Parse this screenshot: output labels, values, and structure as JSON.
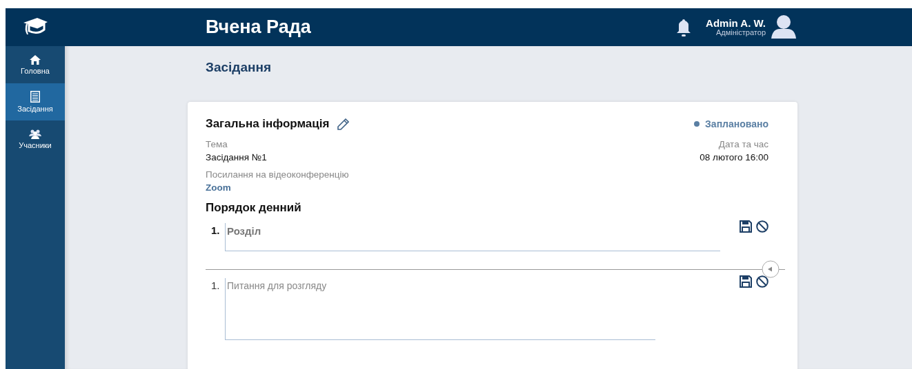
{
  "header": {
    "title": "Вчена Рада",
    "user_name": "Admin A. W.",
    "user_role": "Адміністратор"
  },
  "sidebar": {
    "items": [
      {
        "label": "Головна",
        "kind": "home",
        "selected": false
      },
      {
        "label": "Засідання",
        "kind": "list",
        "selected": true
      },
      {
        "label": "Учасники",
        "kind": "people",
        "selected": false
      }
    ]
  },
  "page_title": "Засідання",
  "card": {
    "title": "Загальна інформація",
    "status": "Заплановано",
    "topic": {
      "label": "Тема",
      "value": "Засідання №1"
    },
    "date_time": {
      "label": "Дата та час",
      "value": "08 лютого 16:00"
    },
    "video_link": {
      "label": "Посилання на відеоконференцію",
      "value": "Zoom"
    },
    "agenda_title": "Порядок денний",
    "section": {
      "number": "1.",
      "placeholder": "Розділ"
    },
    "question": {
      "number": "1.",
      "placeholder": "Питання для розгляду"
    }
  }
}
